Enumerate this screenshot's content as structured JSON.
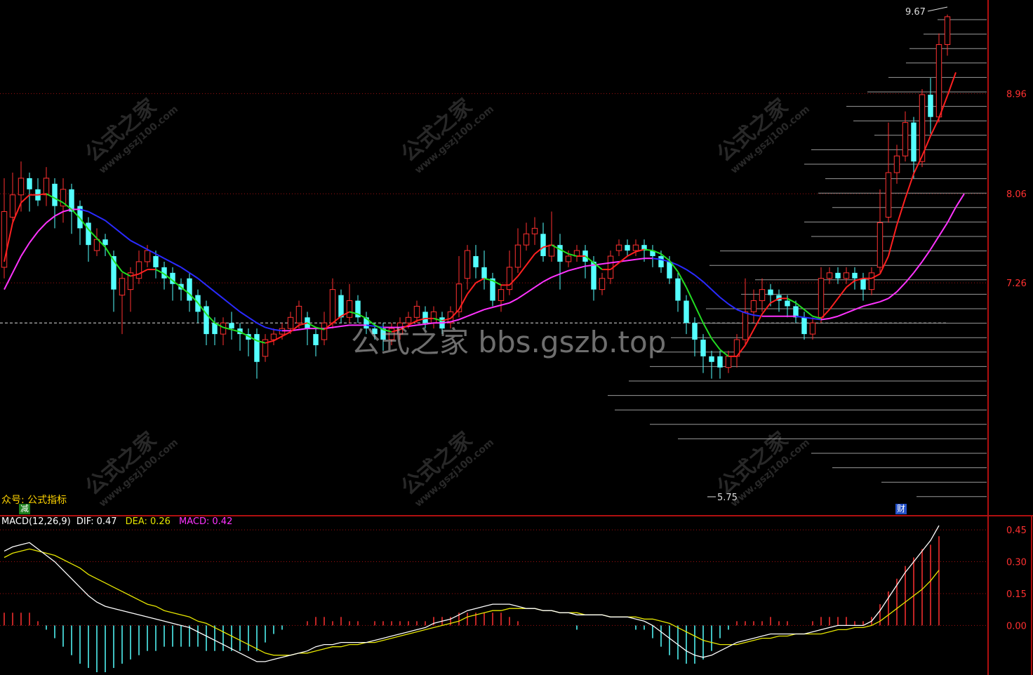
{
  "price_axis_ticks": [
    "8.96",
    "8.06",
    "7.26"
  ],
  "macd_axis_ticks": [
    "0.45",
    "0.30",
    "0.15",
    "0.00"
  ],
  "high_label": "9.67",
  "low_label": "5.75",
  "note_text": "众号: 公式指标",
  "badge_left": "减",
  "badge_right": "财",
  "watermark_main": "公式之家 bbs.gszb.top",
  "watermark_tile": {
    "big": "公式之家",
    "small": "www.gszj100.com"
  },
  "indicator": {
    "name": "MACD(12,26,9)",
    "dif_label": "DIF:",
    "dif_value": "0.47",
    "dea_label": "DEA:",
    "dea_value": "0.26",
    "macd_label": "MACD:",
    "macd_value": "0.42"
  },
  "colors": {
    "up": "#ff3030",
    "down": "#54ffff",
    "grid": "#a01010",
    "ma_fast_up": "#ff2020",
    "ma_fast_down": "#22dd22",
    "ma_slow_up": "#ff33ff",
    "ma_slow_down": "#2a2aff",
    "dif": "#ffffff",
    "dea": "#e6e600",
    "macd_label": "#ff33ff",
    "axis_text_price": "#ff3030",
    "axis_text_macd": "#ff3030"
  },
  "chart_data": [
    {
      "type": "candlestick",
      "ylim": [
        5.2,
        9.75
      ],
      "gridlines": [
        8.96,
        8.06,
        7.26
      ],
      "reference_line": 6.9,
      "candles": [
        [
          7.4,
          7.9,
          7.3,
          8.2
        ],
        [
          7.85,
          8.05,
          7.8,
          8.25
        ],
        [
          8.05,
          8.2,
          7.9,
          8.35
        ],
        [
          8.2,
          8.1,
          7.9,
          8.25
        ],
        [
          8.1,
          8.0,
          7.95,
          8.2
        ],
        [
          8.05,
          8.2,
          7.95,
          8.3
        ],
        [
          8.15,
          7.95,
          7.75,
          8.2
        ],
        [
          7.95,
          8.1,
          7.8,
          8.2
        ],
        [
          8.1,
          7.9,
          7.7,
          8.15
        ],
        [
          7.95,
          7.75,
          7.6,
          8.0
        ],
        [
          7.8,
          7.6,
          7.45,
          7.85
        ],
        [
          7.55,
          7.65,
          7.5,
          7.75
        ],
        [
          7.65,
          7.6,
          7.5,
          7.7
        ],
        [
          7.5,
          7.2,
          7.0,
          7.55
        ],
        [
          7.15,
          7.3,
          6.8,
          7.35
        ],
        [
          7.2,
          7.35,
          7.0,
          7.4
        ],
        [
          7.3,
          7.45,
          7.25,
          7.55
        ],
        [
          7.45,
          7.55,
          7.4,
          7.6
        ],
        [
          7.5,
          7.4,
          7.3,
          7.55
        ],
        [
          7.4,
          7.3,
          7.2,
          7.45
        ],
        [
          7.35,
          7.25,
          7.1,
          7.4
        ],
        [
          7.25,
          7.2,
          7.1,
          7.3
        ],
        [
          7.3,
          7.1,
          7.0,
          7.35
        ],
        [
          7.15,
          7.0,
          6.9,
          7.2
        ],
        [
          7.05,
          6.8,
          6.7,
          7.1
        ],
        [
          6.9,
          6.8,
          6.7,
          6.95
        ],
        [
          6.8,
          6.9,
          6.7,
          6.95
        ],
        [
          6.9,
          6.85,
          6.75,
          7.0
        ],
        [
          6.85,
          6.8,
          6.65,
          6.9
        ],
        [
          6.8,
          6.75,
          6.6,
          6.85
        ],
        [
          6.8,
          6.55,
          6.4,
          6.85
        ],
        [
          6.6,
          6.75,
          6.55,
          6.8
        ],
        [
          6.75,
          6.8,
          6.7,
          6.85
        ],
        [
          6.8,
          6.85,
          6.75,
          6.9
        ],
        [
          6.85,
          6.95,
          6.8,
          7.0
        ],
        [
          6.9,
          7.05,
          6.85,
          7.1
        ],
        [
          6.95,
          6.85,
          6.7,
          7.0
        ],
        [
          6.8,
          6.7,
          6.6,
          6.85
        ],
        [
          6.75,
          6.9,
          6.7,
          7.0
        ],
        [
          6.9,
          7.2,
          6.85,
          7.3
        ],
        [
          7.15,
          6.95,
          6.9,
          7.2
        ],
        [
          6.95,
          7.1,
          6.9,
          7.25
        ],
        [
          7.1,
          6.95,
          6.9,
          7.15
        ],
        [
          6.95,
          6.85,
          6.8,
          7.0
        ],
        [
          6.85,
          6.8,
          6.75,
          6.9
        ],
        [
          6.85,
          6.75,
          6.65,
          6.9
        ],
        [
          6.75,
          6.85,
          6.7,
          6.9
        ],
        [
          6.8,
          6.9,
          6.75,
          6.95
        ],
        [
          6.9,
          6.95,
          6.85,
          7.0
        ],
        [
          6.95,
          7.05,
          6.9,
          7.1
        ],
        [
          7.0,
          6.9,
          6.85,
          7.05
        ],
        [
          6.9,
          7.0,
          6.85,
          7.05
        ],
        [
          6.95,
          6.85,
          6.8,
          7.0
        ],
        [
          6.9,
          7.0,
          6.85,
          7.05
        ],
        [
          7.0,
          7.25,
          6.95,
          7.5
        ],
        [
          7.3,
          7.55,
          7.2,
          7.6
        ],
        [
          7.5,
          7.4,
          7.3,
          7.6
        ],
        [
          7.4,
          7.3,
          7.2,
          7.55
        ],
        [
          7.3,
          7.1,
          7.05,
          7.35
        ],
        [
          7.1,
          7.2,
          7.0,
          7.25
        ],
        [
          7.2,
          7.4,
          7.15,
          7.55
        ],
        [
          7.4,
          7.6,
          7.35,
          7.75
        ],
        [
          7.6,
          7.7,
          7.55,
          7.8
        ],
        [
          7.7,
          7.75,
          7.6,
          7.85
        ],
        [
          7.7,
          7.5,
          7.45,
          7.8
        ],
        [
          7.5,
          7.6,
          7.45,
          7.9
        ],
        [
          7.6,
          7.45,
          7.2,
          7.7
        ],
        [
          7.45,
          7.5,
          7.4,
          7.55
        ],
        [
          7.5,
          7.55,
          7.45,
          7.6
        ],
        [
          7.55,
          7.45,
          7.3,
          7.6
        ],
        [
          7.45,
          7.2,
          7.1,
          7.5
        ],
        [
          7.2,
          7.3,
          7.15,
          7.35
        ],
        [
          7.3,
          7.5,
          7.25,
          7.55
        ],
        [
          7.55,
          7.6,
          7.5,
          7.65
        ],
        [
          7.6,
          7.55,
          7.5,
          7.65
        ],
        [
          7.55,
          7.6,
          7.5,
          7.65
        ],
        [
          7.6,
          7.55,
          7.45,
          7.65
        ],
        [
          7.55,
          7.5,
          7.4,
          7.6
        ],
        [
          7.5,
          7.4,
          7.35,
          7.55
        ],
        [
          7.45,
          7.3,
          7.25,
          7.5
        ],
        [
          7.3,
          7.1,
          7.0,
          7.35
        ],
        [
          7.1,
          6.9,
          6.8,
          7.15
        ],
        [
          6.9,
          6.75,
          6.6,
          6.95
        ],
        [
          6.75,
          6.6,
          6.45,
          6.8
        ],
        [
          6.6,
          6.55,
          6.4,
          6.65
        ],
        [
          6.6,
          6.5,
          6.4,
          6.65
        ],
        [
          6.5,
          6.6,
          6.45,
          6.65
        ],
        [
          6.6,
          6.75,
          6.5,
          6.8
        ],
        [
          6.75,
          7.0,
          6.7,
          7.3
        ],
        [
          7.0,
          7.1,
          6.9,
          7.2
        ],
        [
          7.1,
          7.2,
          7.0,
          7.3
        ],
        [
          7.2,
          7.15,
          7.05,
          7.25
        ],
        [
          7.15,
          7.1,
          7.0,
          7.2
        ],
        [
          7.1,
          7.05,
          6.95,
          7.15
        ],
        [
          7.05,
          6.95,
          6.9,
          7.1
        ],
        [
          6.95,
          6.8,
          6.75,
          7.0
        ],
        [
          6.8,
          6.9,
          6.75,
          6.95
        ],
        [
          6.95,
          7.3,
          6.9,
          7.4
        ],
        [
          7.3,
          7.35,
          7.25,
          7.4
        ],
        [
          7.35,
          7.3,
          7.25,
          7.4
        ],
        [
          7.3,
          7.35,
          7.25,
          7.4
        ],
        [
          7.35,
          7.3,
          7.2,
          7.4
        ],
        [
          7.3,
          7.2,
          7.1,
          7.35
        ],
        [
          7.2,
          7.35,
          7.15,
          7.4
        ],
        [
          7.4,
          7.8,
          7.35,
          8.1
        ],
        [
          7.85,
          8.25,
          7.8,
          8.7
        ],
        [
          8.25,
          8.4,
          8.15,
          8.5
        ],
        [
          8.4,
          8.7,
          8.35,
          8.8
        ],
        [
          8.7,
          8.35,
          8.2,
          8.75
        ],
        [
          8.35,
          8.95,
          8.3,
          9.0
        ],
        [
          8.95,
          8.75,
          8.6,
          9.1
        ],
        [
          8.75,
          9.4,
          8.7,
          9.5
        ],
        [
          9.4,
          9.65,
          9.3,
          9.67
        ]
      ],
      "ma_fast": [
        7.45,
        7.8,
        7.98,
        8.05,
        8.05,
        8.06,
        8.02,
        7.98,
        7.92,
        7.84,
        7.74,
        7.66,
        7.58,
        7.46,
        7.36,
        7.32,
        7.34,
        7.38,
        7.38,
        7.34,
        7.28,
        7.22,
        7.16,
        7.08,
        6.98,
        6.9,
        6.86,
        6.84,
        6.82,
        6.78,
        6.74,
        6.72,
        6.74,
        6.78,
        6.82,
        6.88,
        6.9,
        6.86,
        6.84,
        6.9,
        6.96,
        7.0,
        6.98,
        6.94,
        6.88,
        6.84,
        6.82,
        6.84,
        6.88,
        6.92,
        6.94,
        6.94,
        6.92,
        6.94,
        7.02,
        7.16,
        7.26,
        7.3,
        7.28,
        7.24,
        7.24,
        7.32,
        7.42,
        7.52,
        7.58,
        7.6,
        7.56,
        7.52,
        7.5,
        7.5,
        7.44,
        7.38,
        7.38,
        7.44,
        7.5,
        7.54,
        7.56,
        7.55,
        7.52,
        7.46,
        7.36,
        7.22,
        7.06,
        6.9,
        6.76,
        6.66,
        6.6,
        6.6,
        6.7,
        6.84,
        6.98,
        7.08,
        7.12,
        7.12,
        7.08,
        7.02,
        6.96,
        6.94,
        7.02,
        7.12,
        7.22,
        7.28,
        7.3,
        7.3,
        7.34,
        7.5,
        7.78,
        8.02,
        8.24,
        8.4,
        8.58,
        8.74,
        8.94,
        9.15
      ],
      "ma_slow": [
        7.2,
        7.35,
        7.5,
        7.62,
        7.72,
        7.8,
        7.86,
        7.9,
        7.92,
        7.92,
        7.9,
        7.86,
        7.82,
        7.76,
        7.7,
        7.64,
        7.6,
        7.56,
        7.52,
        7.48,
        7.44,
        7.4,
        7.35,
        7.3,
        7.24,
        7.18,
        7.12,
        7.06,
        7.0,
        6.95,
        6.9,
        6.86,
        6.84,
        6.83,
        6.83,
        6.84,
        6.85,
        6.85,
        6.85,
        6.86,
        6.87,
        6.88,
        6.88,
        6.88,
        6.87,
        6.86,
        6.86,
        6.86,
        6.87,
        6.88,
        6.89,
        6.9,
        6.9,
        6.91,
        6.93,
        6.96,
        6.99,
        7.02,
        7.04,
        7.06,
        7.08,
        7.12,
        7.17,
        7.22,
        7.27,
        7.31,
        7.34,
        7.37,
        7.39,
        7.41,
        7.42,
        7.43,
        7.44,
        7.45,
        7.46,
        7.47,
        7.48,
        7.48,
        7.47,
        7.45,
        7.42,
        7.38,
        7.33,
        7.27,
        7.2,
        7.13,
        7.07,
        7.02,
        6.99,
        6.97,
        6.96,
        6.96,
        6.96,
        6.96,
        6.96,
        6.95,
        6.94,
        6.93,
        6.94,
        6.96,
        6.99,
        7.02,
        7.05,
        7.07,
        7.09,
        7.12,
        7.18,
        7.26,
        7.35,
        7.45,
        7.56,
        7.68,
        7.8,
        7.94,
        8.06
      ]
    },
    {
      "type": "macd",
      "ylim": [
        -0.22,
        0.5
      ],
      "gridlines": [
        0.45,
        0.3,
        0.15,
        0.0
      ],
      "dif": [
        0.35,
        0.37,
        0.38,
        0.39,
        0.36,
        0.33,
        0.3,
        0.26,
        0.22,
        0.18,
        0.14,
        0.11,
        0.09,
        0.08,
        0.07,
        0.06,
        0.05,
        0.04,
        0.03,
        0.02,
        0.01,
        0.0,
        -0.01,
        -0.03,
        -0.05,
        -0.07,
        -0.09,
        -0.11,
        -0.13,
        -0.15,
        -0.17,
        -0.17,
        -0.16,
        -0.15,
        -0.14,
        -0.13,
        -0.12,
        -0.1,
        -0.09,
        -0.09,
        -0.08,
        -0.08,
        -0.08,
        -0.08,
        -0.07,
        -0.06,
        -0.05,
        -0.04,
        -0.03,
        -0.02,
        -0.01,
        0.01,
        0.02,
        0.03,
        0.05,
        0.07,
        0.08,
        0.09,
        0.1,
        0.1,
        0.1,
        0.09,
        0.08,
        0.08,
        0.07,
        0.07,
        0.06,
        0.06,
        0.05,
        0.05,
        0.05,
        0.05,
        0.04,
        0.04,
        0.04,
        0.03,
        0.02,
        0.0,
        -0.03,
        -0.06,
        -0.09,
        -0.12,
        -0.14,
        -0.15,
        -0.14,
        -0.12,
        -0.1,
        -0.08,
        -0.07,
        -0.06,
        -0.05,
        -0.04,
        -0.04,
        -0.04,
        -0.04,
        -0.04,
        -0.03,
        -0.02,
        -0.01,
        0.0,
        0.0,
        0.0,
        0.0,
        0.02,
        0.07,
        0.13,
        0.19,
        0.25,
        0.3,
        0.35,
        0.4,
        0.47
      ],
      "dea": [
        0.32,
        0.34,
        0.35,
        0.36,
        0.35,
        0.34,
        0.33,
        0.31,
        0.29,
        0.27,
        0.24,
        0.22,
        0.2,
        0.18,
        0.16,
        0.14,
        0.12,
        0.1,
        0.09,
        0.07,
        0.06,
        0.05,
        0.04,
        0.02,
        0.01,
        -0.01,
        -0.03,
        -0.05,
        -0.07,
        -0.09,
        -0.11,
        -0.13,
        -0.14,
        -0.14,
        -0.14,
        -0.13,
        -0.13,
        -0.12,
        -0.11,
        -0.1,
        -0.1,
        -0.09,
        -0.09,
        -0.08,
        -0.08,
        -0.07,
        -0.06,
        -0.05,
        -0.04,
        -0.03,
        -0.02,
        -0.01,
        0.0,
        0.01,
        0.02,
        0.04,
        0.05,
        0.06,
        0.07,
        0.07,
        0.08,
        0.08,
        0.08,
        0.08,
        0.07,
        0.07,
        0.06,
        0.06,
        0.06,
        0.05,
        0.05,
        0.05,
        0.04,
        0.04,
        0.04,
        0.04,
        0.03,
        0.03,
        0.02,
        0.01,
        -0.01,
        -0.03,
        -0.05,
        -0.07,
        -0.08,
        -0.09,
        -0.09,
        -0.09,
        -0.08,
        -0.07,
        -0.06,
        -0.06,
        -0.05,
        -0.05,
        -0.04,
        -0.04,
        -0.04,
        -0.04,
        -0.03,
        -0.02,
        -0.02,
        -0.01,
        -0.01,
        0.0,
        0.02,
        0.05,
        0.08,
        0.11,
        0.14,
        0.17,
        0.21,
        0.26
      ]
    }
  ]
}
